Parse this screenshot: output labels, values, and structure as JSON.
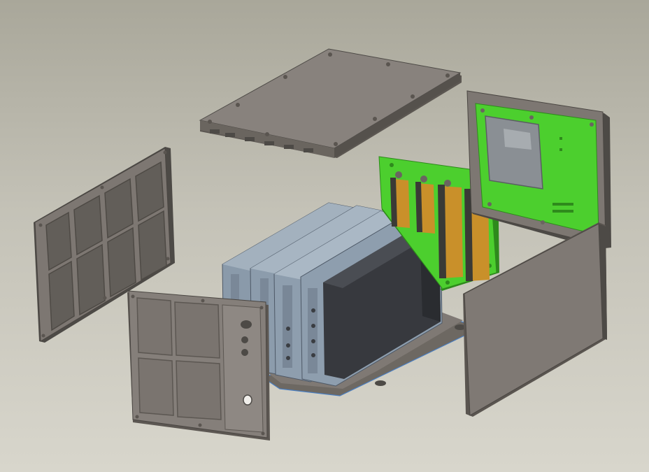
{
  "scene": {
    "description_name": "exploded-enclosure-assembly",
    "colors": {
      "background_top": "#a9a79a",
      "background_bottom": "#d8d6cc",
      "housing_face": "#86807b",
      "housing_dark": "#4d4a46",
      "housing_edge": "#5c5752",
      "pocket": "#635f5a",
      "pcb_green": "#4ccf2e",
      "pcb_dark": "#2e8a1c",
      "connector_gold": "#c9902a",
      "module_blue": "#8e9eae",
      "module_dark": "#36393e",
      "plate_blue_edge": "#4a7ec0"
    },
    "parts": [
      "top-cover",
      "left-side-panel",
      "front-panel",
      "card-modules",
      "backplane-pcb",
      "rear-panel-with-pcb",
      "right-side-panel",
      "base-plate"
    ]
  }
}
